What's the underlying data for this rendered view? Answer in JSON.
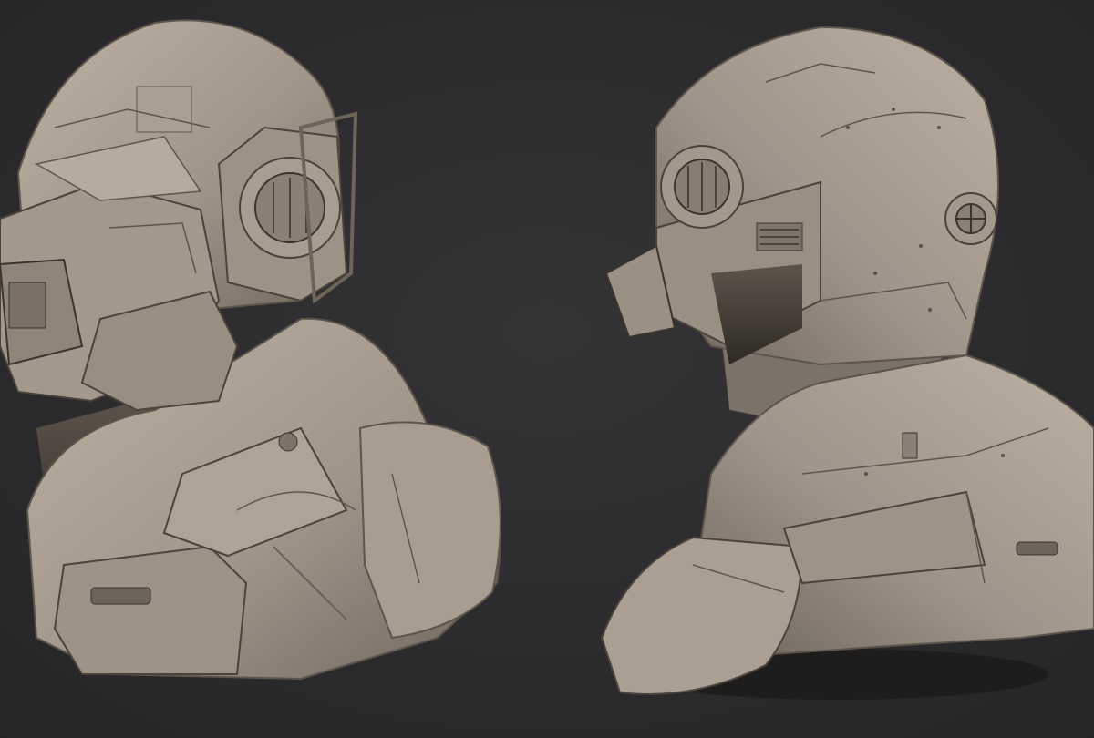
{
  "scene": {
    "subjects": [
      "left-three-quarter-view",
      "right-three-quarter-view"
    ],
    "colors": {
      "background": "#2b2b2d",
      "material_light": "#b4a89a",
      "material_mid": "#8f8477",
      "material_dark": "#5d554c",
      "material_shadow": "#3a342e",
      "panel_line": "#4a433b"
    }
  }
}
